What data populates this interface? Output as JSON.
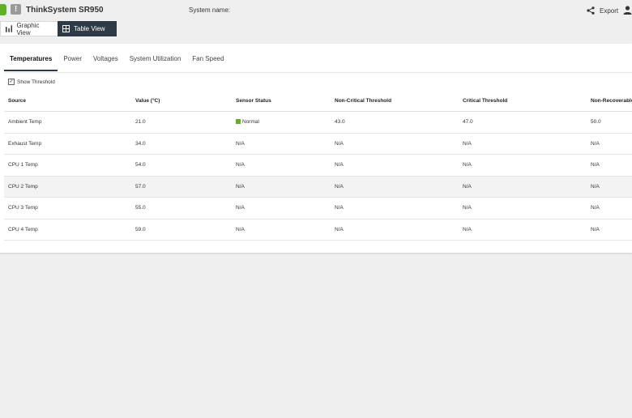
{
  "header": {
    "product_name": "ThinkSystem SR950",
    "system_name_label": "System name:",
    "export_label": "Export",
    "alert_glyph": "!"
  },
  "view_toggle": {
    "graphic_label": "Graphic View",
    "table_label": "Table View",
    "active": "Table View"
  },
  "tabs": [
    "Temperatures",
    "Power",
    "Voltages",
    "System Utilization",
    "Fan Speed"
  ],
  "active_tab": "Temperatures",
  "show_threshold": {
    "label": "Show Threshold",
    "checked": true
  },
  "table": {
    "columns": [
      "Source",
      "Value (°C)",
      "Sensor Status",
      "Non-Critical Threshold",
      "Critical Threshold",
      "Non-Recoverable"
    ],
    "rows": [
      [
        "Ambient Temp",
        "21.0",
        "Normal",
        "43.0",
        "47.0",
        "50.0"
      ],
      [
        "Exhaust Temp",
        "34.0",
        "N/A",
        "N/A",
        "N/A",
        "N/A"
      ],
      [
        "CPU 1 Temp",
        "54.0",
        "N/A",
        "N/A",
        "N/A",
        "N/A"
      ],
      [
        "CPU 2 Temp",
        "57.0",
        "N/A",
        "N/A",
        "N/A",
        "N/A"
      ],
      [
        "CPU 3 Temp",
        "55.0",
        "N/A",
        "N/A",
        "N/A",
        "N/A"
      ],
      [
        "CPU 4 Temp",
        "59.0",
        "N/A",
        "N/A",
        "N/A",
        "N/A"
      ]
    ]
  },
  "colors": {
    "accent_dark": "#2e3a45",
    "status_normal": "#5fb228"
  }
}
